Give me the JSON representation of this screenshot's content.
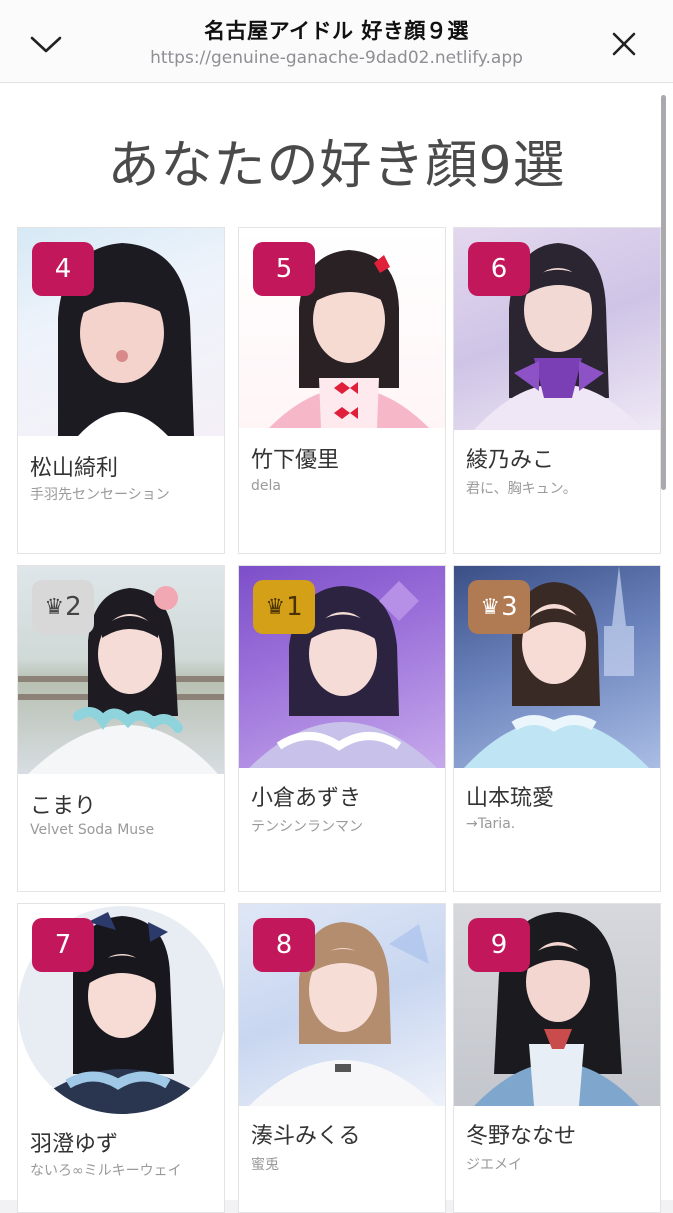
{
  "header": {
    "title": "名古屋アイドル 好き顔９選",
    "url": "https://genuine-ganache-9dad02.netlify.app",
    "collapse_icon": "chevron-down-icon",
    "close_icon": "close-icon"
  },
  "page": {
    "heading": "あなたの好き顔9選"
  },
  "colors": {
    "rank_badge": "#c2185b",
    "gold": "#d4a017",
    "silver": "#d8d8d8",
    "bronze": "#b07a52"
  },
  "cards": [
    {
      "badge": "4",
      "name": "松山綺利",
      "group": "手羽先センセーション"
    },
    {
      "badge": "5",
      "name": "竹下優里",
      "group": "dela"
    },
    {
      "badge": "6",
      "name": "綾乃みこ",
      "group": "君に、胸キュン。"
    },
    {
      "badge": "2",
      "crown": "♛",
      "name": "こまり",
      "group": "Velvet Soda Muse"
    },
    {
      "badge": "1",
      "crown": "♛",
      "name": "小倉あずき",
      "group": "テンシンランマン"
    },
    {
      "badge": "3",
      "crown": "♛",
      "name": "山本琉愛",
      "group": "→Taria."
    },
    {
      "badge": "7",
      "name": "羽澄ゆず",
      "group": "ないろ∞ミルキーウェイ"
    },
    {
      "badge": "8",
      "name": "湊斗みくる",
      "group": "蜜兎"
    },
    {
      "badge": "9",
      "name": "冬野ななせ",
      "group": "ジエメイ"
    }
  ]
}
